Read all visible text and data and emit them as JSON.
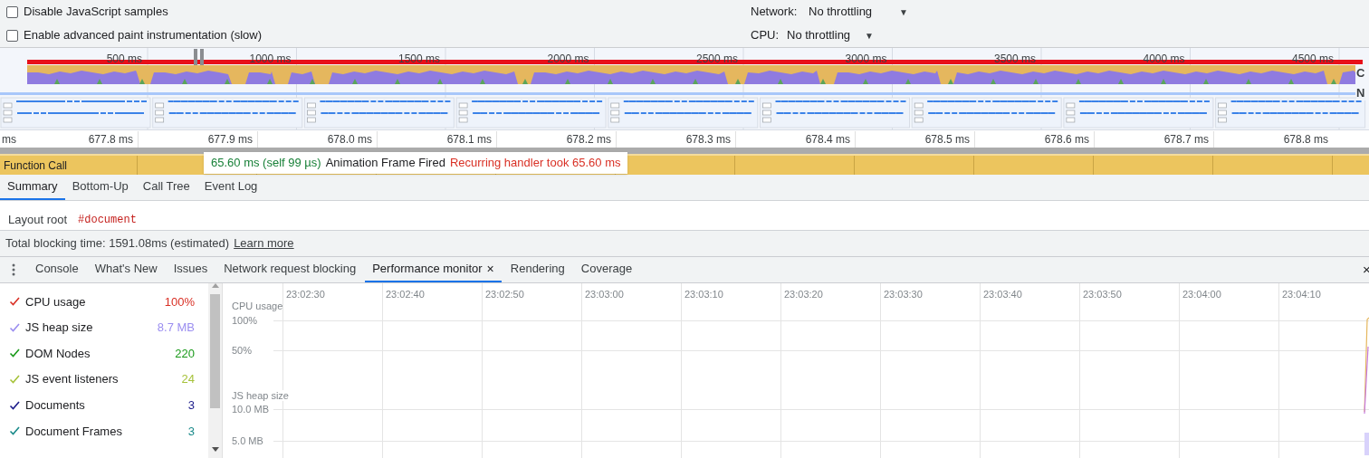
{
  "settings": [
    {
      "label": "Disable JavaScript samples",
      "checked": false
    },
    {
      "label": "Enable advanced paint instrumentation (slow)",
      "checked": false
    }
  ],
  "throttling": [
    {
      "label": "Network:",
      "value": "No throttling",
      "arrow": "▼"
    },
    {
      "label": "CPU:",
      "value": "No throttling",
      "arrow": "▼"
    }
  ],
  "overview": {
    "ticks": [
      "500 ms",
      "1000 ms",
      "1500 ms",
      "2000 ms",
      "2500 ms",
      "3000 ms",
      "3500 ms",
      "4000 ms",
      "4500 ms"
    ],
    "track_labels": [
      "C",
      "N"
    ]
  },
  "ruler": {
    "unit": "ms",
    "ticks": [
      "677.8 ms",
      "677.9 ms",
      "678.0 ms",
      "678.1 ms",
      "678.2 ms",
      "678.3 ms",
      "678.4 ms",
      "678.5 ms",
      "678.6 ms",
      "678.7 ms",
      "678.8 ms"
    ]
  },
  "flame": {
    "label": "Function Call"
  },
  "tooltip": {
    "duration": "65.60 ms (self 99 µs)",
    "event": "Animation Frame Fired",
    "warning": "Recurring handler took 65.60 ms"
  },
  "detail_tabs": [
    {
      "label": "Summary",
      "selected": true
    },
    {
      "label": "Bottom-Up",
      "selected": false
    },
    {
      "label": "Call Tree",
      "selected": false
    },
    {
      "label": "Event Log",
      "selected": false
    }
  ],
  "summary": {
    "layout_root_label": "Layout root",
    "layout_root": "#document"
  },
  "footer": {
    "text": "Total blocking time: 1591.08ms (estimated)",
    "link": "Learn more"
  },
  "drawer": {
    "close": "×",
    "tabs": [
      {
        "label": "Console",
        "selected": false
      },
      {
        "label": "What's New",
        "selected": false
      },
      {
        "label": "Issues",
        "selected": false
      },
      {
        "label": "Network request blocking",
        "selected": false
      },
      {
        "label": "Performance monitor",
        "selected": true,
        "close": "×"
      },
      {
        "label": "Rendering",
        "selected": false
      },
      {
        "label": "Coverage",
        "selected": false
      }
    ]
  },
  "metrics": [
    {
      "name": "CPU usage",
      "value": "100%",
      "color": "#d93025",
      "checked": true
    },
    {
      "name": "JS heap size",
      "value": "8.7 MB",
      "color": "#9b8ef0",
      "checked": true
    },
    {
      "name": "DOM Nodes",
      "value": "220",
      "color": "#1a9a1a",
      "checked": true
    },
    {
      "name": "JS event listeners",
      "value": "24",
      "color": "#a6c23a",
      "checked": true
    },
    {
      "name": "Documents",
      "value": "3",
      "color": "#1c1c8a",
      "checked": true
    },
    {
      "name": "Document Frames",
      "value": "3",
      "color": "#1a8a8a",
      "checked": true
    }
  ],
  "monitor": {
    "times": [
      "23:02:30",
      "23:02:40",
      "23:02:50",
      "23:03:00",
      "23:03:10",
      "23:03:20",
      "23:03:30",
      "23:03:40",
      "23:03:50",
      "23:04:00",
      "23:04:10"
    ],
    "cpu_label": "CPU usage",
    "cpu_ticks": [
      "100%",
      "50%"
    ],
    "heap_label": "JS heap size",
    "heap_ticks": [
      "10.0 MB",
      "5.0 MB"
    ]
  }
}
